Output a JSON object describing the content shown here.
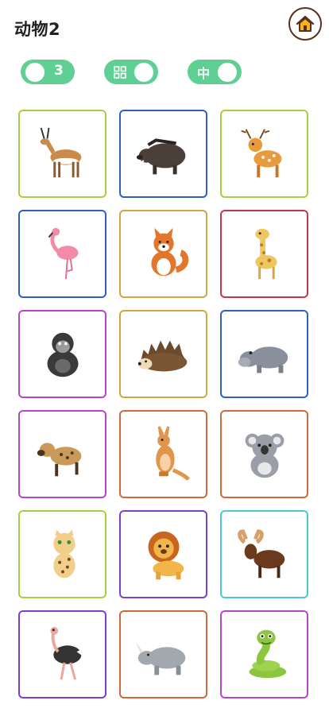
{
  "header": {
    "title": "动物2",
    "home_icon": "home-icon"
  },
  "controls": {
    "count_value": "3",
    "size_label": "中",
    "grid_icon": "grid-icon",
    "toggle_color": "#5fcf94"
  },
  "cards": [
    {
      "animal": "antelope",
      "border": "#a9cf3e"
    },
    {
      "animal": "boar",
      "border": "#2c5fc9"
    },
    {
      "animal": "deer",
      "border": "#a9cf3e"
    },
    {
      "animal": "flamingo",
      "border": "#2c5fc9"
    },
    {
      "animal": "fox",
      "border": "#d4a63c"
    },
    {
      "animal": "giraffe",
      "border": "#c5364b"
    },
    {
      "animal": "gorilla",
      "border": "#b446c8"
    },
    {
      "animal": "hedgehog",
      "border": "#d4a63c"
    },
    {
      "animal": "hippo",
      "border": "#2c5fc9"
    },
    {
      "animal": "hyena",
      "border": "#b446c8"
    },
    {
      "animal": "kangaroo",
      "border": "#d06a3a"
    },
    {
      "animal": "koala",
      "border": "#d06a3a"
    },
    {
      "animal": "leopard",
      "border": "#a9cf3e"
    },
    {
      "animal": "lion",
      "border": "#7d3fd0"
    },
    {
      "animal": "moose",
      "border": "#4cc7d6"
    },
    {
      "animal": "ostrich",
      "border": "#7d3fd0"
    },
    {
      "animal": "rhino",
      "border": "#d06a3a"
    },
    {
      "animal": "snake",
      "border": "#b446c8"
    }
  ]
}
